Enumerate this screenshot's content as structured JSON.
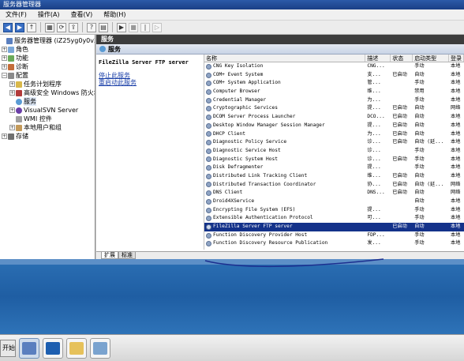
{
  "window": {
    "title": "服务器管理器"
  },
  "menu": [
    "文件(F)",
    "操作(A)",
    "查看(V)",
    "帮助(H)"
  ],
  "toolbar": {
    "buttons": [
      {
        "label": "◀",
        "icon": "back-icon"
      },
      {
        "label": "▶",
        "icon": "forward-icon"
      },
      {
        "label": "↑",
        "icon": "up-icon"
      },
      {
        "label": "▦",
        "icon": "show-tree-icon"
      },
      {
        "label": "⟳",
        "icon": "refresh-icon"
      },
      {
        "label": "⇪",
        "icon": "export-icon"
      },
      {
        "label": "?",
        "icon": "help-icon"
      },
      {
        "label": "▤",
        "icon": "properties-icon"
      },
      {
        "label": "▶",
        "icon": "start-service-icon"
      },
      {
        "label": "■",
        "icon": "stop-service-icon"
      },
      {
        "label": "‖",
        "icon": "pause-service-icon"
      },
      {
        "label": "▷",
        "icon": "restart-service-icon"
      }
    ]
  },
  "tree": {
    "root": "服务器管理器 (iZ25yg0y0v3Z)",
    "items": [
      {
        "label": "角色",
        "indent": 1,
        "exp": "+"
      },
      {
        "label": "功能",
        "indent": 1,
        "exp": "+"
      },
      {
        "label": "诊断",
        "indent": 1,
        "exp": "+"
      },
      {
        "label": "配置",
        "indent": 1,
        "exp": "−"
      },
      {
        "label": "任务计划程序",
        "indent": 2,
        "exp": "+"
      },
      {
        "label": "高级安全 Windows 防火墙",
        "indent": 2,
        "exp": "+"
      },
      {
        "label": "服务",
        "indent": 2,
        "exp": ""
      },
      {
        "label": "VisualSVN Server",
        "indent": 2,
        "exp": "+"
      },
      {
        "label": "WMI 控件",
        "indent": 2,
        "exp": ""
      },
      {
        "label": "本地用户和组",
        "indent": 2,
        "exp": "+"
      },
      {
        "label": "存储",
        "indent": 1,
        "exp": "+"
      }
    ]
  },
  "panel": {
    "header": "服务",
    "bar_title": "服务",
    "selected_name": "FileZilla Server FTP server",
    "stop_link": "停止此服务",
    "restart_link": "重启动此服务"
  },
  "columns": [
    "名称",
    "描述",
    "状态",
    "启动类型",
    "登录"
  ],
  "services": [
    [
      "CNG Key Isolation",
      "CNG...",
      "",
      "手动",
      "本地"
    ],
    [
      "COM+ Event System",
      "支...",
      "已启动",
      "自动",
      "本地"
    ],
    [
      "COM+ System Application",
      "管...",
      "",
      "手动",
      "本地"
    ],
    [
      "Computer Browser",
      "维...",
      "",
      "禁用",
      "本地"
    ],
    [
      "Credential Manager",
      "为...",
      "",
      "手动",
      "本地"
    ],
    [
      "Cryptographic Services",
      "提...",
      "已启动",
      "自动",
      "网络"
    ],
    [
      "DCOM Server Process Launcher",
      "DCO...",
      "已启动",
      "自动",
      "本地"
    ],
    [
      "Desktop Window Manager Session Manager",
      "提...",
      "已启动",
      "自动",
      "本地"
    ],
    [
      "DHCP Client",
      "为...",
      "已启动",
      "自动",
      "本地"
    ],
    [
      "Diagnostic Policy Service",
      "诊...",
      "已启动",
      "自动 (延...",
      "本地"
    ],
    [
      "Diagnostic Service Host",
      "诊...",
      "",
      "手动",
      "本地"
    ],
    [
      "Diagnostic System Host",
      "诊...",
      "已启动",
      "手动",
      "本地"
    ],
    [
      "Disk Defragmenter",
      "提...",
      "",
      "手动",
      "本地"
    ],
    [
      "Distributed Link Tracking Client",
      "维...",
      "已启动",
      "自动",
      "本地"
    ],
    [
      "Distributed Transaction Coordinator",
      "协...",
      "已启动",
      "自动 (延...",
      "网络"
    ],
    [
      "DNS Client",
      "DNS...",
      "已启动",
      "自动",
      "网络"
    ],
    [
      "Droid4XService",
      "",
      "",
      "自动",
      "本地"
    ],
    [
      "Encrypting File System (EFS)",
      "提...",
      "",
      "手动",
      "本地"
    ],
    [
      "Extensible Authentication Protocol",
      "可...",
      "",
      "手动",
      "本地"
    ],
    [
      "FileZilla Server FTP server",
      "",
      "已启动",
      "自动",
      "本地"
    ],
    [
      "Function Discovery Provider Host",
      "FDP...",
      "",
      "手动",
      "本地"
    ],
    [
      "Function Discovery Resource Publication",
      "发...",
      "",
      "手动",
      "本地"
    ]
  ],
  "tabs": [
    "扩展",
    "标准"
  ],
  "taskbar": {
    "start": "开始"
  },
  "colors": {
    "selection": "#14328a",
    "desktop": "#2468ae",
    "pen": "#1c2f8f"
  }
}
